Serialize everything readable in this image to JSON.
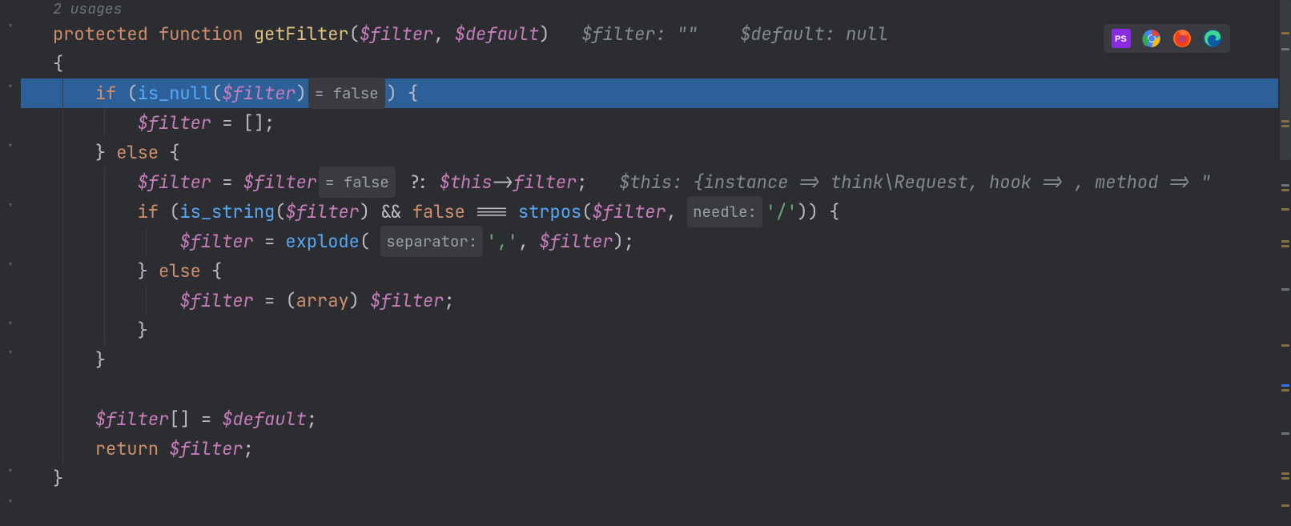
{
  "usages": "2 usages",
  "sigHint": {
    "filter": "$filter: \"\"",
    "default": "$default: null"
  },
  "code": {
    "kw_protected": "protected",
    "kw_function": "function",
    "fn_name": "getFilter",
    "param1": "$filter",
    "param2": "$default",
    "brace_open": "{",
    "brace_close": "}",
    "kw_if": "if",
    "kw_else": "else",
    "kw_return": "return",
    "kw_false": "false",
    "kw_array": "array",
    "fn_isnull": "is_null",
    "fn_isstring": "is_string",
    "fn_strpos": "strpos",
    "fn_explode": "explode",
    "var_filter": "$filter",
    "var_default": "$default",
    "var_this": "$this",
    "prop_filter": "filter",
    "empty_array": "[]",
    "eq_false1": "= false",
    "eq_false2": "= false",
    "ternary": "?:",
    "triple_eq": "===",
    "str_slash": "'/'",
    "str_comma": "','",
    "needle_label": "needle:",
    "separator_label": "separator:",
    "thisHint": "$this: {instance => think\\Request, hook => , method => \""
  },
  "browserIcons": [
    "phpstorm",
    "chrome",
    "firefox",
    "edge"
  ]
}
